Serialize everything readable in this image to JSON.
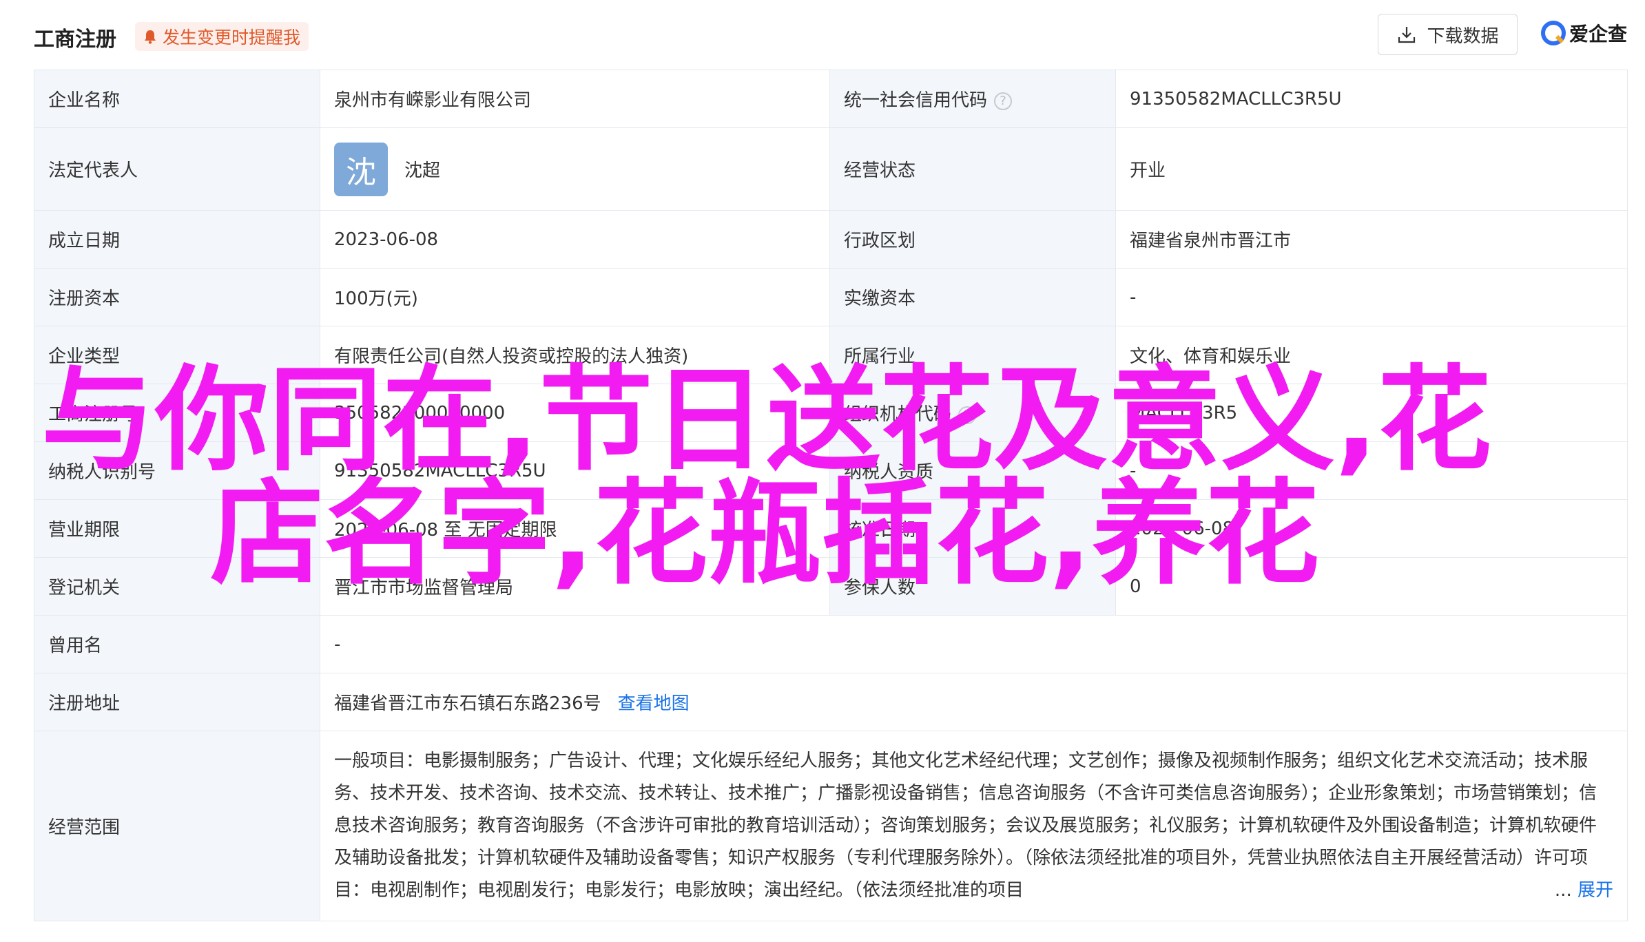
{
  "header": {
    "title": "工商注册",
    "alert_label": "发生变更时提醒我",
    "download_label": "下载数据",
    "logo_text": "爱企查"
  },
  "rows": [
    {
      "l1": "企业名称",
      "v1": "泉州市有嵘影业有限公司",
      "l2": "统一社会信用代码",
      "v2": "91350582MACLLC3R5U"
    },
    {
      "l1": "法定代表人",
      "avatar": "沈",
      "v1": "沈超",
      "l2": "经营状态",
      "v2": "开业"
    },
    {
      "l1": "成立日期",
      "v1": "2023-06-08",
      "l2": "行政区划",
      "v2": "福建省泉州市晋江市"
    },
    {
      "l1": "注册资本",
      "v1": "100万(元)",
      "l2": "实缴资本",
      "v2": "-"
    },
    {
      "l1": "企业类型",
      "v1": "有限责任公司(自然人投资或控股的法人独资)",
      "l2": "所属行业",
      "v2": "文化、体育和娱乐业"
    },
    {
      "l1": "工商注册号",
      "v1": "350582200000000",
      "l2": "组织机构代码",
      "v2": "MACLLC3R5"
    },
    {
      "l1": "纳税人识别号",
      "v1": "91350582MACLLC3R5U",
      "l2": "纳税人资质",
      "v2": "-"
    },
    {
      "l1": "营业期限",
      "v1": "2023-06-08 至 无固定期限",
      "l2": "核准日期",
      "v2": "2023-06-08"
    },
    {
      "l1": "登记机关",
      "v1": "晋江市市场监督管理局",
      "l2": "参保人数",
      "v2": "0"
    },
    {
      "l1": "曾用名",
      "v1": "-"
    },
    {
      "l1": "注册地址",
      "v1": "福建省晋江市东石镇石东路236号",
      "link": "查看地图"
    },
    {
      "l1": "经营范围",
      "v1": "一般项目：电影摄制服务；广告设计、代理；文化娱乐经纪人服务；其他文化艺术经纪代理；文艺创作；摄像及视频制作服务；组织文化艺术交流活动；技术服务、技术开发、技术咨询、技术交流、技术转让、技术推广；广播影视设备销售；信息咨询服务（不含许可类信息咨询服务）；企业形象策划；市场营销策划；信息技术咨询服务；教育咨询服务（不含涉许可审批的教育培训活动）；咨询策划服务；会议及展览服务；礼仪服务；计算机软硬件及外围设备制造；计算机软硬件及辅助设备批发；计算机软硬件及辅助设备零售；知识产权服务（专利代理服务除外）。（除依法须经批准的项目外，凭营业执照依法自主开展经营活动）许可项目：电视剧制作；电视剧发行；电影发行；电影放映；演出经纪。（依法须经批准的项目",
      "expand_dots": "...",
      "expand_label": "展开"
    }
  ],
  "watermark": {
    "line1": "与你同在,节日送花及意义,花",
    "line2": "店名字,花瓶插花,养花"
  },
  "colors": {
    "alert": "#e0592a",
    "link": "#1a73e8",
    "label_bg": "#f3f6fa",
    "border": "#e4e9f0",
    "watermark": "#f21cf2"
  }
}
